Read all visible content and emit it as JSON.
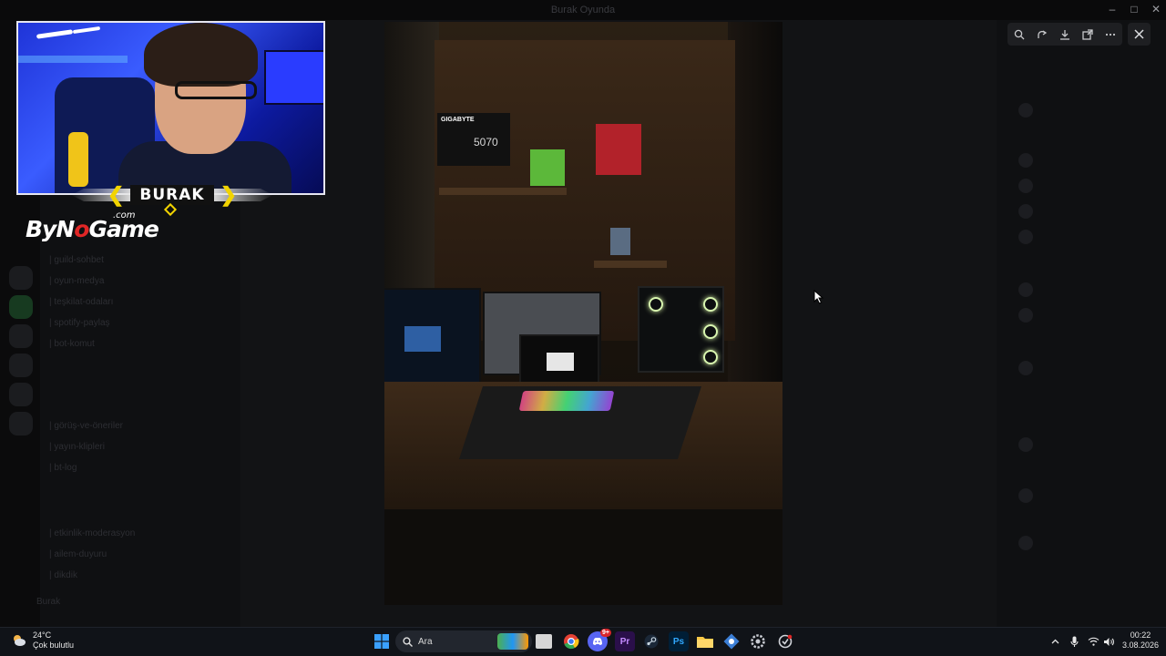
{
  "window": {
    "title": "Burak Oyunda",
    "controls": {
      "minimize": "–",
      "maximize": "□",
      "close": "✕"
    }
  },
  "channels": [
    "| guild-sohbet",
    "| oyun-medya",
    "| teşkilat-odaları",
    "| spotify-paylaş",
    "| bot-komut",
    "| görüş-ve-öneriler",
    "| yayın-klipleri",
    "| bt-log",
    "| etkinlik-moderasyon",
    "| ailem-duyuru",
    "| dikdik"
  ],
  "members_header": "Burak",
  "viewer": {
    "tools": [
      "zoom-in-icon",
      "rotate-icon",
      "download-icon",
      "open-external-icon",
      "more-icon"
    ],
    "close_icon": "close-icon"
  },
  "overlay": {
    "banner_name": "BURAK",
    "logo_prefix": "ByN",
    "logo_accent": "o",
    "logo_suffix": "Game",
    "logo_domain": ".com"
  },
  "photo_labels": {
    "gpu_brand": "GIGABYTE",
    "gpu_model": "5070"
  },
  "taskbar": {
    "weather_temp": "24°C",
    "weather_desc": "Çok bulutlu",
    "search_placeholder": "Ara",
    "discord_badge": "9+",
    "premiere_label": "Pr",
    "photoshop_label": "Ps",
    "time": "00:22",
    "date": "3.08.2026"
  },
  "colors": {
    "accent_yellow": "#f2d400",
    "logo_red": "#e02626",
    "cam_blue": "#2a3cff",
    "taskbar_bg": "#101318"
  }
}
